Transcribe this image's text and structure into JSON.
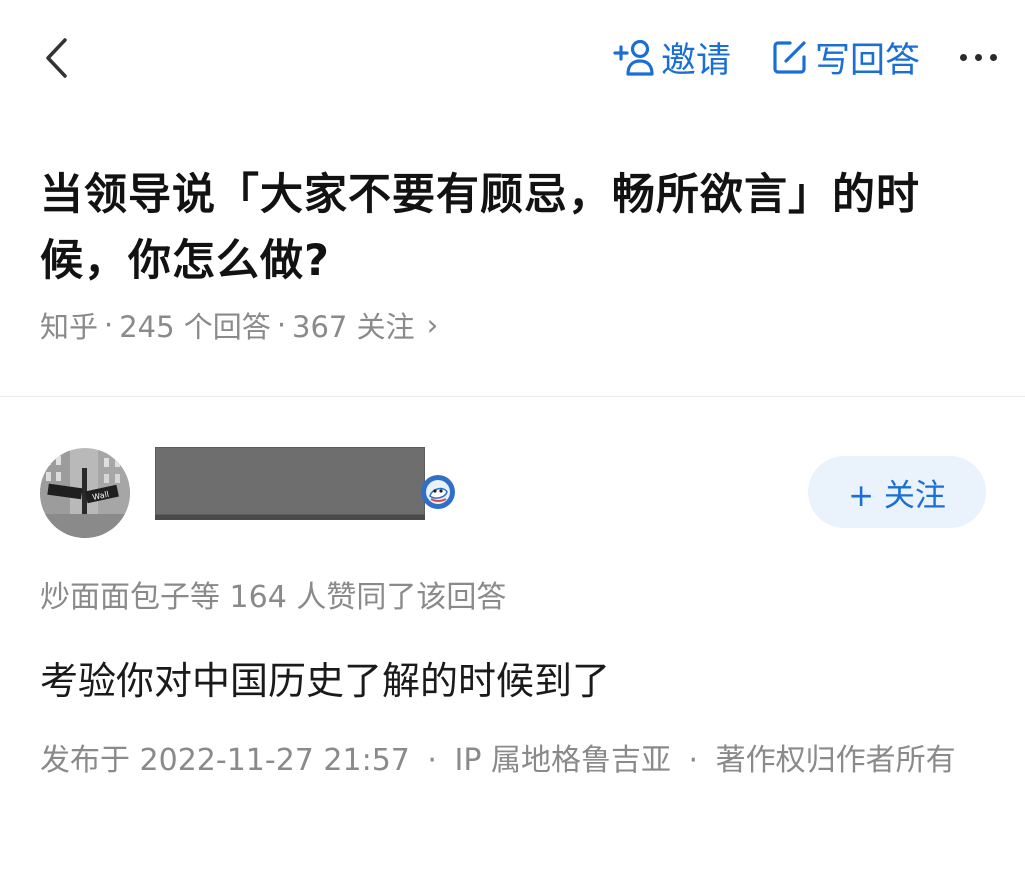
{
  "topbar": {
    "invite_label": "邀请",
    "write_answer_label": "写回答",
    "accent_color": "#1a6fd6",
    "icons": [
      "chevron-left-icon",
      "add-person-icon",
      "edit-icon",
      "more-icon"
    ]
  },
  "question": {
    "title": "当领导说「大家不要有顾忌，畅所欲言」的时候，你怎么做?",
    "meta": {
      "source": "知乎",
      "separator": "·",
      "answers": "245 个回答",
      "followers": "367 关注",
      "chevron": "›"
    }
  },
  "answer": {
    "follow_label": "+ 关注",
    "likes_text": "炒面面包子等 164 人赞同了该回答",
    "content": "考验你对中国历史了解的时候到了",
    "publish": {
      "time": "发布于 2022-11-27 21:57",
      "separator": "·",
      "ip": "IP 属地格鲁吉亚",
      "copyright": "著作权归作者所有"
    }
  }
}
